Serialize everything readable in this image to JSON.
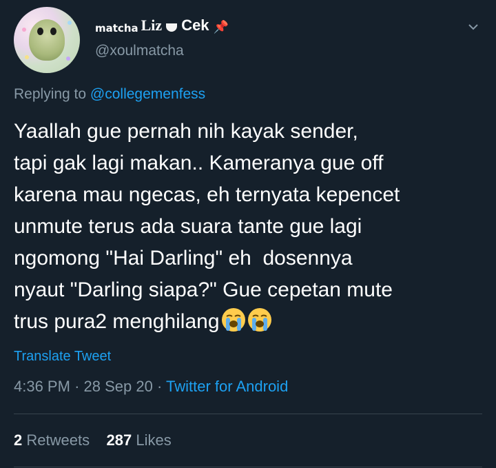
{
  "header": {
    "display_name_prefix": "matcha",
    "display_name_main": "Liz",
    "display_name_suffix": "Cek",
    "handle": "@xoulmatcha"
  },
  "icons": {
    "cup": "teacup-icon",
    "pin": "pushpin-icon",
    "menu": "chevron-down-icon",
    "emoji": "loudly-crying-face-icon"
  },
  "replying": {
    "label": "Replying to",
    "mention": "@collegemenfess"
  },
  "tweet": {
    "text": "Yaallah gue pernah nih kayak sender,\ntapi gak lagi makan.. Kameranya gue off\nkarena mau ngecas, eh ternyata kepencet\nunmute terus ada suara tante gue lagi\nngomong \"Hai Darling\" eh  dosennya\nnyaut \"Darling siapa?\" Gue cepetan mute\ntrus pura2 menghilang"
  },
  "translate_label": "Translate Tweet",
  "meta": {
    "time": "4:36 PM",
    "date": "28 Sep 20",
    "separator": "·",
    "client": "Twitter for Android"
  },
  "stats": {
    "retweets_count": "2",
    "retweets_label": "Retweets",
    "likes_count": "287",
    "likes_label": "Likes"
  },
  "colors": {
    "background": "#15202b",
    "text": "#ffffff",
    "muted": "#8899a6",
    "link": "#1da1f2",
    "divider": "#38444d"
  }
}
